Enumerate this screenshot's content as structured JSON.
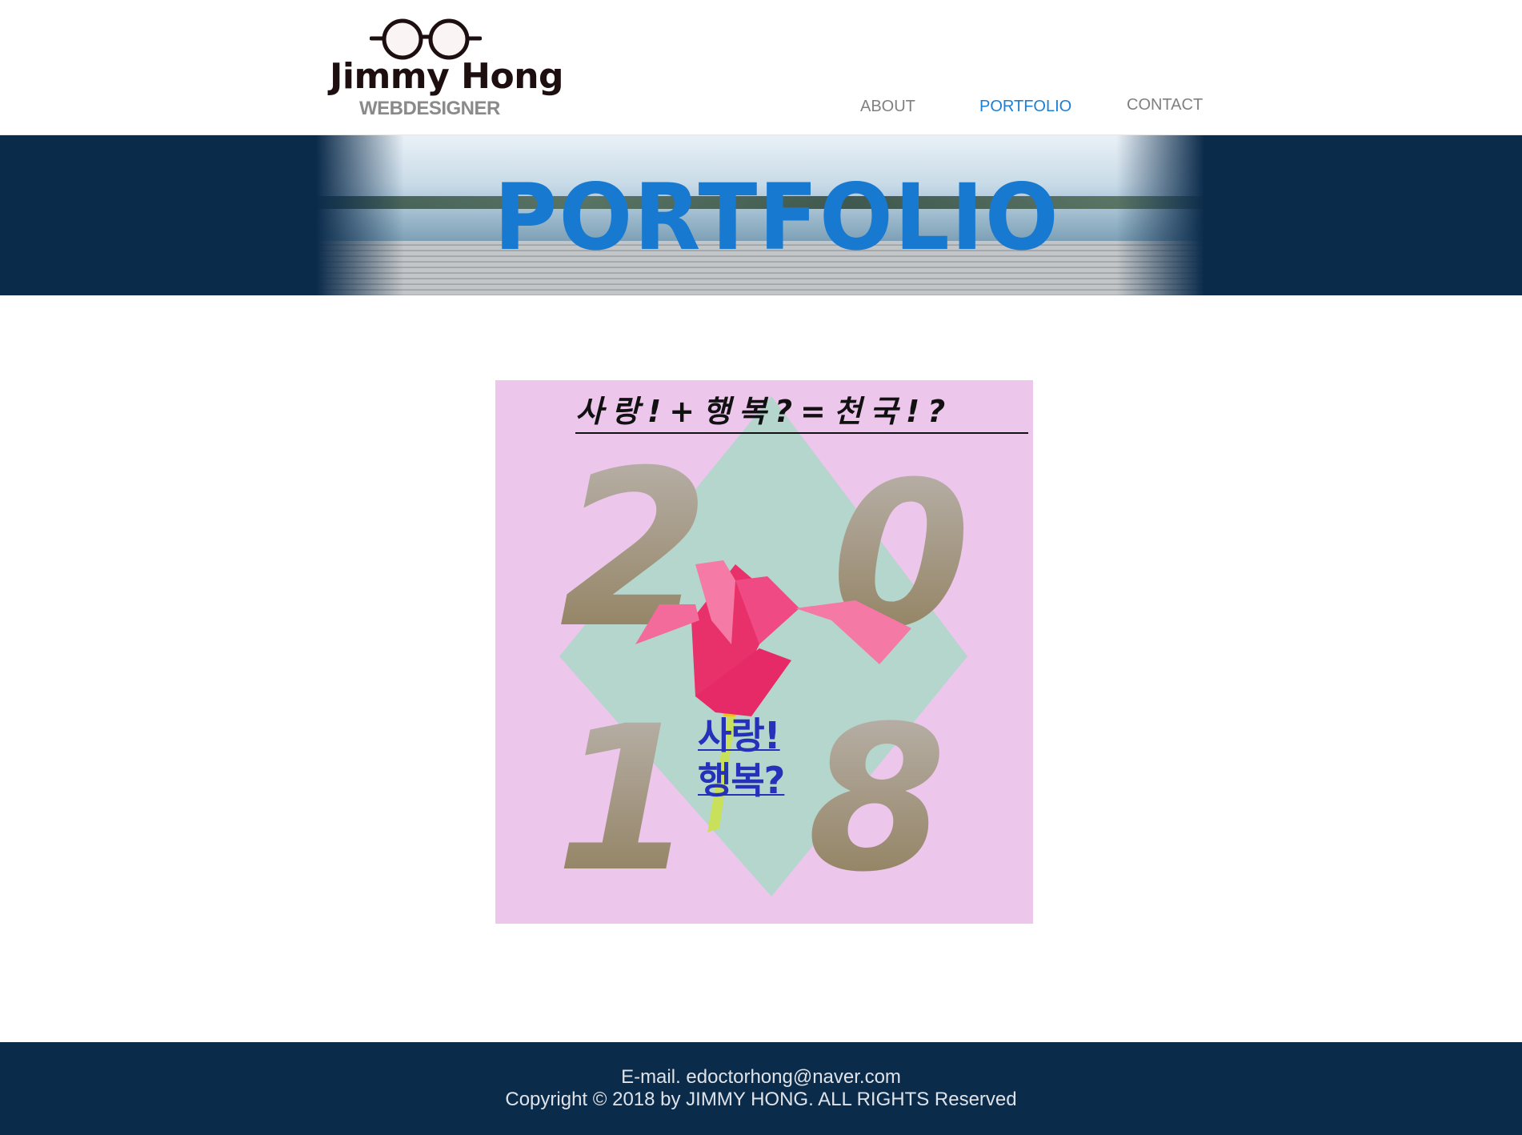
{
  "header": {
    "logo_name": "Jimmy Hong",
    "logo_subtitle": "WEBDESIGNER",
    "nav": [
      {
        "label": "ABOUT",
        "active": false
      },
      {
        "label": "PORTFOLIO",
        "active": true
      },
      {
        "label": "CONTACT",
        "active": false
      }
    ]
  },
  "banner": {
    "title": "PORTFOLIO"
  },
  "poster": {
    "heading": "사랑!+행복?=천국!?",
    "year_digits": [
      "2",
      "0",
      "1",
      "8"
    ],
    "line1": "사랑!",
    "line2": "행복?"
  },
  "footer": {
    "email": "E-mail. edoctorhong@naver.com",
    "copyright": "Copyright © 2018 by JIMMY HONG. ALL RIGHTS Reserved"
  },
  "colors": {
    "nav_active": "#1a7fd6",
    "nav_default": "#808080",
    "banner_bg": "#0b2b4b",
    "banner_title": "#1779d0",
    "poster_bg": "#ecc6eb",
    "poster_diamond": "#b4d6cd",
    "poster_text": "#2431b8",
    "footer_bg": "#0b2b4b"
  }
}
